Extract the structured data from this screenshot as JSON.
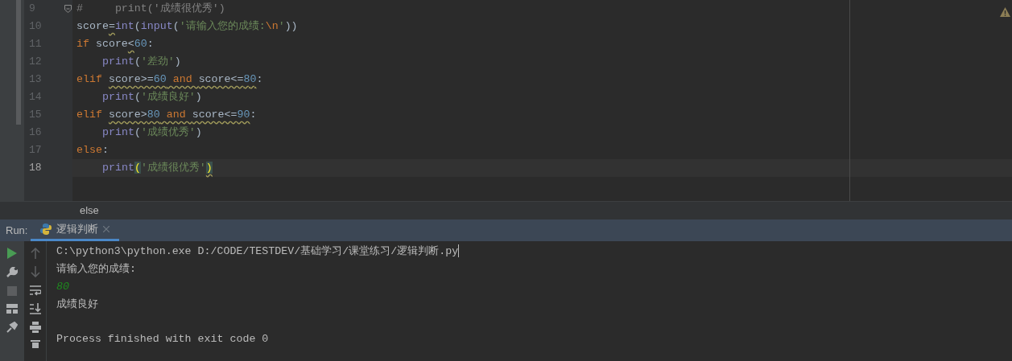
{
  "editor": {
    "lines": [
      {
        "number": "9",
        "current": false,
        "fold": true,
        "indented": false,
        "tokens": [
          {
            "kind": "comment",
            "text": "#     print('成绩很优秀')"
          }
        ]
      },
      {
        "number": "10",
        "current": false,
        "fold": false,
        "indented": false,
        "tokens": [
          {
            "kind": "plain",
            "text": "score"
          },
          {
            "kind": "plain",
            "text": "=",
            "warning": true
          },
          {
            "kind": "builtin",
            "text": "int"
          },
          {
            "kind": "plain",
            "text": "("
          },
          {
            "kind": "builtin",
            "text": "input"
          },
          {
            "kind": "plain",
            "text": "("
          },
          {
            "kind": "string",
            "text": "'请输入您的成绩:"
          },
          {
            "kind": "escape",
            "text": "\\n"
          },
          {
            "kind": "string",
            "text": "'"
          },
          {
            "kind": "plain",
            "text": "))"
          }
        ]
      },
      {
        "number": "11",
        "current": false,
        "fold": false,
        "indented": false,
        "tokens": [
          {
            "kind": "keyword",
            "text": "if "
          },
          {
            "kind": "plain",
            "text": "score"
          },
          {
            "kind": "plain",
            "text": "<",
            "warning": true
          },
          {
            "kind": "number",
            "text": "60"
          },
          {
            "kind": "plain",
            "text": ":"
          }
        ]
      },
      {
        "number": "12",
        "current": false,
        "fold": false,
        "indented": true,
        "tokens": [
          {
            "kind": "builtin",
            "text": "print"
          },
          {
            "kind": "plain",
            "text": "("
          },
          {
            "kind": "string",
            "text": "'差劲'"
          },
          {
            "kind": "plain",
            "text": ")"
          }
        ]
      },
      {
        "number": "13",
        "current": false,
        "fold": false,
        "indented": false,
        "tokens": [
          {
            "kind": "keyword",
            "text": "elif "
          },
          {
            "kind": "plain",
            "text": "score>=",
            "warning": true
          },
          {
            "kind": "number",
            "text": "60",
            "warning": true
          },
          {
            "kind": "keyword",
            "text": " and ",
            "warning": true
          },
          {
            "kind": "plain",
            "text": "score<=",
            "warning": true
          },
          {
            "kind": "number",
            "text": "80",
            "warning": true
          },
          {
            "kind": "plain",
            "text": ":"
          }
        ]
      },
      {
        "number": "14",
        "current": false,
        "fold": false,
        "indented": true,
        "tokens": [
          {
            "kind": "builtin",
            "text": "print"
          },
          {
            "kind": "plain",
            "text": "("
          },
          {
            "kind": "string",
            "text": "'成绩良好'"
          },
          {
            "kind": "plain",
            "text": ")"
          }
        ]
      },
      {
        "number": "15",
        "current": false,
        "fold": false,
        "indented": false,
        "tokens": [
          {
            "kind": "keyword",
            "text": "elif "
          },
          {
            "kind": "plain",
            "text": "score>",
            "warning": true
          },
          {
            "kind": "number",
            "text": "80",
            "warning": true
          },
          {
            "kind": "keyword",
            "text": " and ",
            "warning": true
          },
          {
            "kind": "plain",
            "text": "score<=",
            "warning": true
          },
          {
            "kind": "number",
            "text": "90",
            "warning": true
          },
          {
            "kind": "plain",
            "text": ":"
          }
        ]
      },
      {
        "number": "16",
        "current": false,
        "fold": false,
        "indented": true,
        "tokens": [
          {
            "kind": "builtin",
            "text": "print"
          },
          {
            "kind": "plain",
            "text": "("
          },
          {
            "kind": "string",
            "text": "'成绩优秀'"
          },
          {
            "kind": "plain",
            "text": ")"
          }
        ]
      },
      {
        "number": "17",
        "current": false,
        "fold": false,
        "indented": false,
        "tokens": [
          {
            "kind": "keyword",
            "text": "else"
          },
          {
            "kind": "plain",
            "text": ":"
          }
        ]
      },
      {
        "number": "18",
        "current": true,
        "fold": false,
        "indented": true,
        "tokens": [
          {
            "kind": "builtin",
            "text": "print"
          },
          {
            "kind": "brace",
            "text": "("
          },
          {
            "kind": "string",
            "text": "'成绩很优秀'"
          },
          {
            "kind": "brace",
            "text": ")",
            "warning": true
          }
        ]
      }
    ]
  },
  "breadcrumb": "else",
  "run": {
    "label": "Run:",
    "tabs": [
      {
        "title": "逻辑判断",
        "selected": true
      }
    ],
    "console": [
      {
        "kind": "command",
        "text": "C:\\python3\\python.exe D:/CODE/TESTDEV/基础学习/课堂练习/逻辑判断.py"
      },
      {
        "kind": "output",
        "text": "请输入您的成绩:"
      },
      {
        "kind": "input",
        "text": "80"
      },
      {
        "kind": "output",
        "text": "成绩良好"
      },
      {
        "kind": "exit",
        "text": "Process finished with exit code 0"
      }
    ]
  }
}
